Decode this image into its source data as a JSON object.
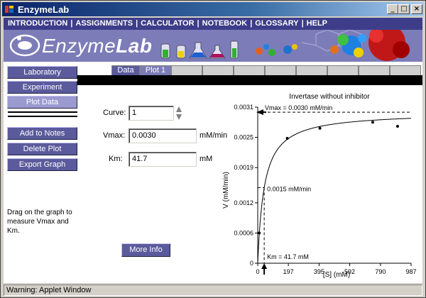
{
  "window": {
    "title": "EnzymeLab",
    "minimize": "_",
    "maximize": "□",
    "close": "×"
  },
  "menu": {
    "items": [
      "INTRODUCTION",
      "ASSIGNMENTS",
      "CALCULATOR",
      "NOTEBOOK",
      "GLOSSARY",
      "HELP"
    ],
    "separator": "|"
  },
  "banner": {
    "logo_prefix": "Enzyme",
    "logo_suffix": "Lab"
  },
  "sidebar": {
    "laboratory": "Laboratory",
    "experiment": "Experiment",
    "plot_data": "Plot Data",
    "add_to_notes": "Add to Notes",
    "delete_plot": "Delete Plot",
    "export_graph": "Export Graph"
  },
  "help_text": "Drag on the graph to measure Vmax and Km.",
  "tabs": {
    "data": "Data",
    "plot1": "Plot 1"
  },
  "form": {
    "curve_label": "Curve:",
    "curve_value": "1",
    "vmax_label": "Vmax:",
    "vmax_value": "0.0030",
    "vmax_unit": "mM/min",
    "km_label": "Km:",
    "km_value": "41.7",
    "km_unit": "mM"
  },
  "more_info": "More Info",
  "status_bar": "Warning: Applet Window",
  "chart_data": {
    "type": "scatter",
    "title": "Invertase without inhibitor",
    "xlabel": "[S] (mM)",
    "ylabel": "V (mM/min)",
    "xlim": [
      0,
      987
    ],
    "ylim": [
      0,
      0.0031
    ],
    "x_ticks": [
      "0",
      "197",
      "395",
      "592",
      "790",
      "987"
    ],
    "x_tick_values": [
      0,
      197,
      395,
      592,
      790,
      987
    ],
    "y_ticks": [
      "0",
      "0.0006",
      "0.0012",
      "0.0019",
      "0.0025",
      "0.0031"
    ],
    "y_tick_values": [
      0,
      0.0006,
      0.0012,
      0.0019,
      0.0025,
      0.0031
    ],
    "points": [
      {
        "x": 10,
        "y": 0.0006
      },
      {
        "x": 190,
        "y": 0.00248
      },
      {
        "x": 400,
        "y": 0.00268
      },
      {
        "x": 740,
        "y": 0.0028
      },
      {
        "x": 900,
        "y": 0.00272
      }
    ],
    "fit": {
      "vmax": 0.003,
      "km": 41.7
    },
    "annotations": {
      "vmax_line": "Vmax = 0.0030 mM/min",
      "half_vmax_line": "0.0015 mM/min",
      "km_line": "Km = 41.7 mM"
    }
  }
}
